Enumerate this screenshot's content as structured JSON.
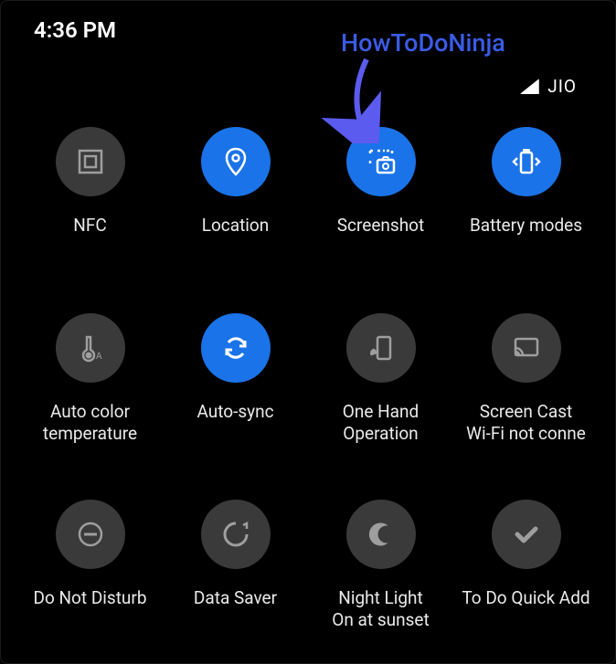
{
  "status": {
    "time": "4:36 PM",
    "carrier": "JIO"
  },
  "watermark": "HowToDoNinja",
  "tiles": [
    {
      "label": "NFC",
      "active": false,
      "icon": "nfc-icon"
    },
    {
      "label": "Location",
      "active": true,
      "icon": "location-icon"
    },
    {
      "label": "Screenshot",
      "active": true,
      "icon": "screenshot-icon"
    },
    {
      "label": "Battery modes",
      "active": true,
      "icon": "battery-modes-icon"
    },
    {
      "label": "Auto color temperature",
      "active": false,
      "icon": "auto-color-temp-icon"
    },
    {
      "label": "Auto-sync",
      "active": true,
      "icon": "auto-sync-icon"
    },
    {
      "label": "One Hand Operation",
      "active": false,
      "icon": "one-hand-icon"
    },
    {
      "label": "Screen Cast\nWi-Fi not conne",
      "active": false,
      "icon": "screen-cast-icon"
    },
    {
      "label": "Do Not Disturb",
      "active": false,
      "icon": "dnd-icon"
    },
    {
      "label": "Data Saver",
      "active": false,
      "icon": "data-saver-icon"
    },
    {
      "label": "Night Light\nOn at sunset",
      "active": false,
      "icon": "night-light-icon"
    },
    {
      "label": "To Do Quick Add",
      "active": false,
      "icon": "todo-icon"
    }
  ],
  "colors": {
    "accent": "#1a73e8",
    "tile_off": "#3a3a3a",
    "watermark": "#3b5be8"
  }
}
